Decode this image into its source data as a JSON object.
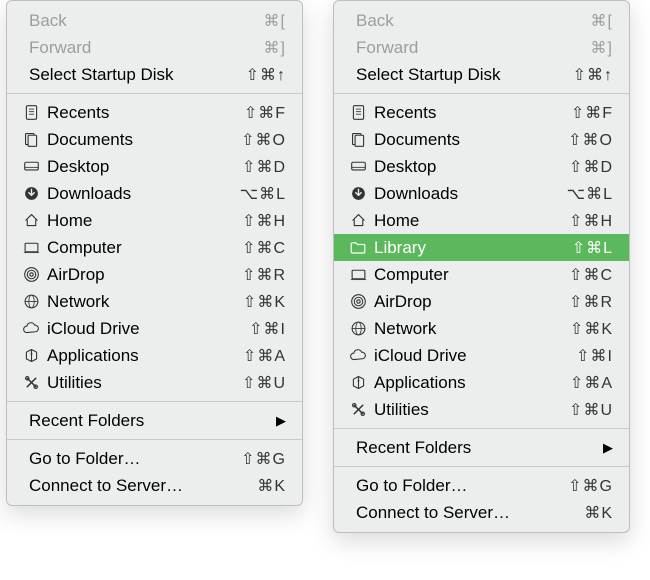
{
  "menus": [
    {
      "id": "left",
      "sections": [
        [
          {
            "key": "back",
            "label": "Back",
            "shortcut": "⌘[",
            "disabled": true
          },
          {
            "key": "forward",
            "label": "Forward",
            "shortcut": "⌘]",
            "disabled": true
          },
          {
            "key": "startup",
            "label": "Select Startup Disk",
            "shortcut": "⇧⌘↑"
          }
        ],
        [
          {
            "key": "recents",
            "label": "Recents",
            "icon": "clock-doc-icon",
            "shortcut": "⇧⌘F"
          },
          {
            "key": "documents",
            "label": "Documents",
            "icon": "documents-icon",
            "shortcut": "⇧⌘O"
          },
          {
            "key": "desktop",
            "label": "Desktop",
            "icon": "desktop-icon",
            "shortcut": "⇧⌘D"
          },
          {
            "key": "downloads",
            "label": "Downloads",
            "icon": "download-icon",
            "shortcut": "⌥⌘L"
          },
          {
            "key": "home",
            "label": "Home",
            "icon": "home-icon",
            "shortcut": "⇧⌘H"
          },
          {
            "key": "computer",
            "label": "Computer",
            "icon": "computer-icon",
            "shortcut": "⇧⌘C"
          },
          {
            "key": "airdrop",
            "label": "AirDrop",
            "icon": "airdrop-icon",
            "shortcut": "⇧⌘R"
          },
          {
            "key": "network",
            "label": "Network",
            "icon": "network-icon",
            "shortcut": "⇧⌘K"
          },
          {
            "key": "icloud",
            "label": "iCloud Drive",
            "icon": "cloud-icon",
            "shortcut": "⇧⌘I"
          },
          {
            "key": "apps",
            "label": "Applications",
            "icon": "apps-icon",
            "shortcut": "⇧⌘A"
          },
          {
            "key": "utilities",
            "label": "Utilities",
            "icon": "utilities-icon",
            "shortcut": "⇧⌘U"
          }
        ],
        [
          {
            "key": "recent-folders",
            "label": "Recent Folders",
            "submenu": true
          }
        ],
        [
          {
            "key": "gotofolder",
            "label": "Go to Folder…",
            "shortcut": "⇧⌘G"
          },
          {
            "key": "connect",
            "label": "Connect to Server…",
            "shortcut": "⌘K"
          }
        ]
      ]
    },
    {
      "id": "right",
      "sections": [
        [
          {
            "key": "back",
            "label": "Back",
            "shortcut": "⌘[",
            "disabled": true
          },
          {
            "key": "forward",
            "label": "Forward",
            "shortcut": "⌘]",
            "disabled": true
          },
          {
            "key": "startup",
            "label": "Select Startup Disk",
            "shortcut": "⇧⌘↑"
          }
        ],
        [
          {
            "key": "recents",
            "label": "Recents",
            "icon": "clock-doc-icon",
            "shortcut": "⇧⌘F"
          },
          {
            "key": "documents",
            "label": "Documents",
            "icon": "documents-icon",
            "shortcut": "⇧⌘O"
          },
          {
            "key": "desktop",
            "label": "Desktop",
            "icon": "desktop-icon",
            "shortcut": "⇧⌘D"
          },
          {
            "key": "downloads",
            "label": "Downloads",
            "icon": "download-icon",
            "shortcut": "⌥⌘L"
          },
          {
            "key": "home",
            "label": "Home",
            "icon": "home-icon",
            "shortcut": "⇧⌘H"
          },
          {
            "key": "library",
            "label": "Library",
            "icon": "folder-icon",
            "shortcut": "⇧⌘L",
            "highlight": true
          },
          {
            "key": "computer",
            "label": "Computer",
            "icon": "computer-icon",
            "shortcut": "⇧⌘C"
          },
          {
            "key": "airdrop",
            "label": "AirDrop",
            "icon": "airdrop-icon",
            "shortcut": "⇧⌘R"
          },
          {
            "key": "network",
            "label": "Network",
            "icon": "network-icon",
            "shortcut": "⇧⌘K"
          },
          {
            "key": "icloud",
            "label": "iCloud Drive",
            "icon": "cloud-icon",
            "shortcut": "⇧⌘I"
          },
          {
            "key": "apps",
            "label": "Applications",
            "icon": "apps-icon",
            "shortcut": "⇧⌘A"
          },
          {
            "key": "utilities",
            "label": "Utilities",
            "icon": "utilities-icon",
            "shortcut": "⇧⌘U"
          }
        ],
        [
          {
            "key": "recent-folders",
            "label": "Recent Folders",
            "submenu": true
          }
        ],
        [
          {
            "key": "gotofolder",
            "label": "Go to Folder…",
            "shortcut": "⇧⌘G"
          },
          {
            "key": "connect",
            "label": "Connect to Server…",
            "shortcut": "⌘K"
          }
        ]
      ]
    }
  ]
}
